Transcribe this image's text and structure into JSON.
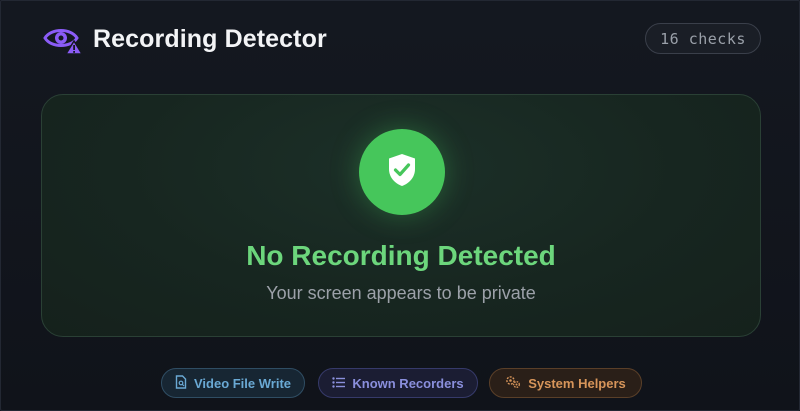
{
  "header": {
    "title": "Recording Detector",
    "icon": "eye-warning-icon",
    "checks_count": "16 checks"
  },
  "status": {
    "icon": "shield-check-icon",
    "title": "No Recording Detected",
    "subtitle": "Your screen appears to be private",
    "accent": "#46c65b"
  },
  "pills": [
    {
      "label": "Video File Write",
      "icon": "document-icon",
      "color": "#6aa9d4"
    },
    {
      "label": "Known Recorders",
      "icon": "list-icon",
      "color": "#8a8fdc"
    },
    {
      "label": "System Helpers",
      "icon": "gears-icon",
      "color": "#d7955a"
    }
  ]
}
